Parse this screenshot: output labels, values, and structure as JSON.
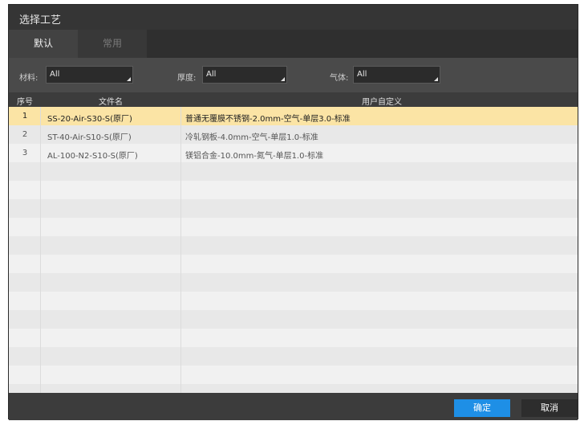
{
  "dialog": {
    "title": "选择工艺",
    "tabs": [
      {
        "label": "默认",
        "active": true
      },
      {
        "label": "常用",
        "active": false
      }
    ],
    "filters": [
      {
        "label": "材料:",
        "value": "All"
      },
      {
        "label": "厚度:",
        "value": "All"
      },
      {
        "label": "气体:",
        "value": "All"
      }
    ],
    "table": {
      "headers": [
        "序号",
        "文件名",
        "用户自定义"
      ],
      "rows": [
        {
          "index": "1",
          "file": "SS-20-Air-S30-S(原厂)",
          "custom": "普通无覆膜不锈钢-2.0mm-空气-单层3.0-标准",
          "selected": true
        },
        {
          "index": "2",
          "file": "ST-40-Air-S10-S(原厂)",
          "custom": "冷轧钢板-4.0mm-空气-单层1.0-标准",
          "selected": false
        },
        {
          "index": "3",
          "file": "AL-100-N2-S10-S(原厂)",
          "custom": "镁铝合金-10.0mm-氮气-单层1.0-标准",
          "selected": false
        }
      ]
    },
    "buttons": {
      "ok": "确定",
      "cancel": "取消"
    },
    "colors": {
      "accent": "#1e8fe6",
      "selected_row": "#fbe4a5"
    }
  }
}
